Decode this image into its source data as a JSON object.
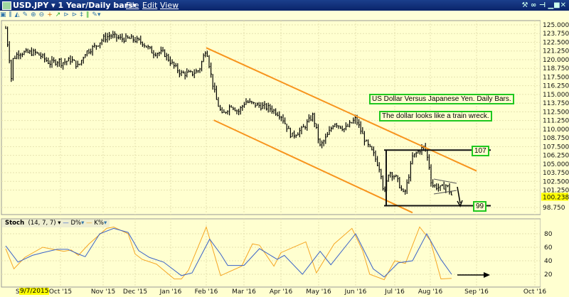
{
  "window": {
    "title": "USD.JPY",
    "timeframe": "1 Year/Daily bars",
    "menu": [
      "File",
      "Edit",
      "View"
    ]
  },
  "toolbar": {
    "icons": [
      "cursor-icon",
      "bar-type-icon",
      "line-icon",
      "area-icon",
      "draw-icon",
      "zoom-in-icon",
      "zoom-out-icon",
      "crosshair-icon",
      "indicator-icon",
      "scroll-left-icon",
      "scroll-right-icon",
      "compress-icon",
      "expand-icon",
      "tools-icon"
    ]
  },
  "price_axis": {
    "labels": [
      "125.000",
      "123.750",
      "122.500",
      "121.250",
      "120.000",
      "118.750",
      "117.500",
      "116.250",
      "115.000",
      "113.750",
      "112.500",
      "111.250",
      "110.000",
      "108.750",
      "107.500",
      "106.250",
      "105.000",
      "103.750",
      "102.500",
      "101.250",
      "98.750"
    ],
    "current": "100.238"
  },
  "annotations": {
    "title": "US Dollar Versus Japanese Yen. Daily Bars.",
    "comment": "The dollar looks like a train wreck.",
    "level_high": "107",
    "level_low": "99"
  },
  "stoch": {
    "name": "Stoch",
    "params": "(14, 7, 7)",
    "d_label": "D%",
    "k_label": "K%",
    "axis": [
      "80",
      "60",
      "40",
      "20"
    ],
    "colors": {
      "d": "#3a62c8",
      "k": "#f5a623"
    }
  },
  "x_axis": {
    "months": [
      "Se",
      "Oct '15",
      "Nov '15",
      "Dec '15",
      "Jan '16",
      "Feb '16",
      "Mar '16",
      "Apr '16",
      "May '16",
      "Jun '16",
      "Jul '16",
      "Aug '16",
      "Sep '16",
      "Oct '16"
    ],
    "cursor_date": "9/7/2015"
  },
  "chart_data": {
    "type": "line",
    "x_unit": "months since Sep 1 2015",
    "price": {
      "ylim": [
        98,
        126
      ],
      "x": [
        0.2,
        0.27,
        0.29,
        0.33,
        0.43,
        0.74,
        0.85,
        1.0,
        1.25,
        1.42,
        1.58,
        1.83,
        2.0,
        2.22,
        2.56,
        2.89,
        3.2,
        3.5,
        3.8,
        4.1,
        4.3,
        4.6,
        4.8,
        5.0,
        5.15,
        5.28,
        5.42,
        5.66,
        5.85,
        6.04,
        6.33,
        6.71,
        7.0,
        7.28,
        7.57,
        7.85,
        8.04,
        8.23,
        8.42,
        8.71,
        9.0,
        9.27,
        9.45,
        9.64,
        9.73,
        9.85,
        10.04,
        10.26,
        10.34,
        10.5,
        10.7,
        10.84,
        10.96,
        11.03,
        11.23,
        11.35,
        11.46
      ],
      "close": [
        124.5,
        120,
        116.3,
        120,
        121,
        121,
        120.5,
        119.5,
        120,
        119,
        121,
        122,
        123,
        123.5,
        123,
        123,
        122.5,
        121,
        121,
        119,
        118,
        118,
        118.5,
        121.7,
        117,
        114,
        112,
        113.5,
        112.5,
        114,
        113.5,
        113,
        112,
        109,
        110,
        112,
        107.5,
        109,
        111,
        110,
        111.5,
        108,
        106.5,
        104,
        100.5,
        104,
        103,
        100.5,
        102,
        106,
        107,
        107.5,
        105,
        102,
        101.5,
        102,
        100.5
      ]
    },
    "trendlines": {
      "upper_channel": [
        [
          5.0,
          121.7
        ],
        [
          12.0,
          104.0
        ]
      ],
      "lower_channel": [
        [
          5.2,
          111.3
        ],
        [
          10.5,
          98.0
        ]
      ],
      "resistance": 107,
      "support": 99
    },
    "stoch_d": {
      "x": [
        0.2,
        0.38,
        0.59,
        0.74,
        0.95,
        1.17,
        1.42,
        1.58,
        1.67,
        1.92,
        2.33,
        2.78,
        3.1,
        3.4,
        3.8,
        4.3,
        4.6,
        5.09,
        5.38,
        5.57,
        6.0,
        6.42,
        6.9,
        7.09,
        7.57,
        8.04,
        8.33,
        9.0,
        9.45,
        9.73,
        10.1,
        10.5,
        10.9,
        11.23,
        11.46
      ],
      "y": [
        62,
        38,
        48,
        52,
        57,
        57,
        50,
        46,
        55,
        80,
        88,
        82,
        55,
        45,
        38,
        18,
        22,
        72,
        50,
        33,
        33,
        58,
        42,
        48,
        20,
        54,
        34,
        80,
        28,
        16,
        37,
        40,
        80,
        42,
        20
      ]
    },
    "stoch_k": {
      "x": [
        0.2,
        0.32,
        0.48,
        0.74,
        1.08,
        1.25,
        1.42,
        1.67,
        2.11,
        2.33,
        2.78,
        3.0,
        3.2,
        3.6,
        4.1,
        4.3,
        4.5,
        5.0,
        5.38,
        5.94,
        6.23,
        6.42,
        6.81,
        7.0,
        7.66,
        7.94,
        8.42,
        8.9,
        9.18,
        9.36,
        9.73,
        10.0,
        10.3,
        10.7,
        11.0,
        11.23,
        11.46
      ],
      "y": [
        58,
        28,
        45,
        60,
        54,
        56,
        48,
        65,
        88,
        90,
        80,
        50,
        42,
        35,
        13,
        13,
        26,
        90,
        18,
        32,
        65,
        63,
        32,
        52,
        68,
        22,
        65,
        88,
        55,
        20,
        12,
        40,
        36,
        90,
        70,
        13,
        14
      ]
    }
  }
}
